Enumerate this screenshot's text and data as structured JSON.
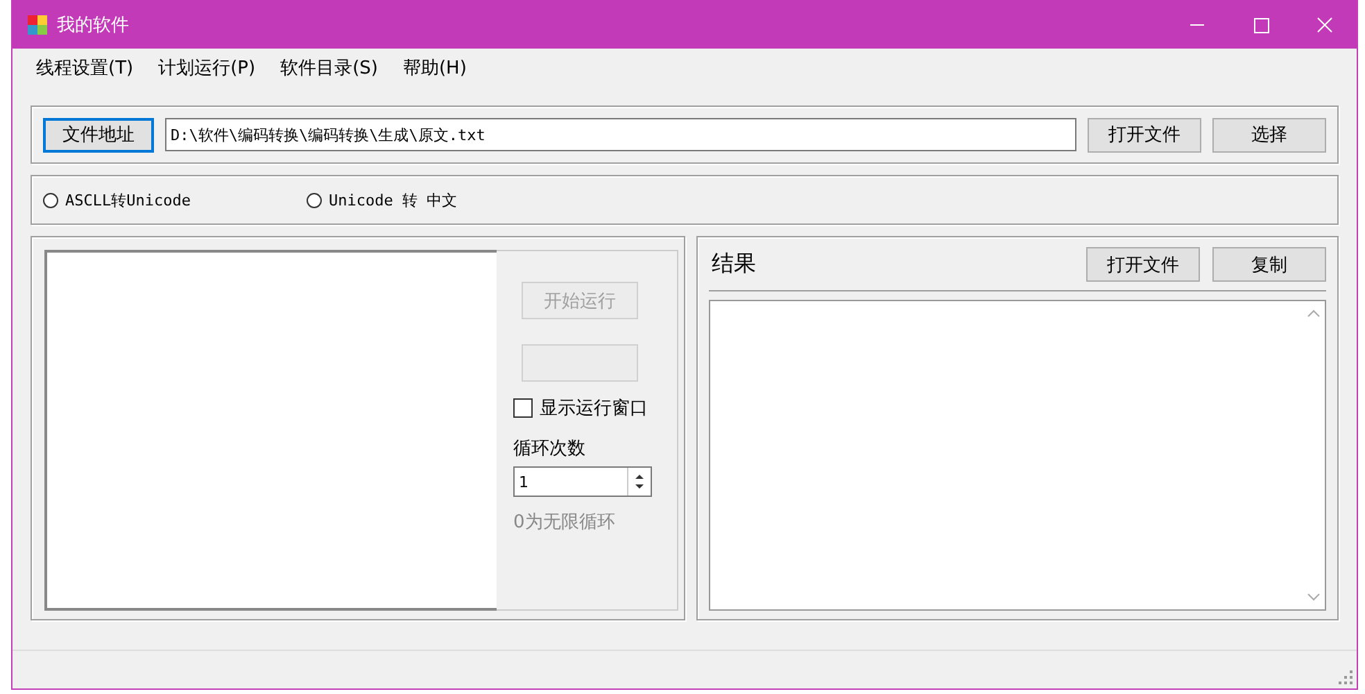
{
  "window": {
    "title": "我的软件"
  },
  "menu": [
    {
      "label": "线程设置(T)"
    },
    {
      "label": "计划运行(P)"
    },
    {
      "label": "软件目录(S)"
    },
    {
      "label": "帮助(H)"
    }
  ],
  "file_row": {
    "button": "文件地址",
    "path": "D:\\软件\\编码转换\\编码转换\\生成\\原文.txt",
    "buttons": [
      "打开文件",
      "选择"
    ]
  },
  "modes": [
    {
      "label": "ASCLL转Unicode",
      "selected": false
    },
    {
      "label": "Unicode 转 中文",
      "selected": false
    }
  ],
  "controls": {
    "start_button": {
      "label": "开始运行",
      "disabled": true
    },
    "second_button": {
      "disabled": true
    },
    "show_window": {
      "label": "显示运行窗口",
      "checked": false
    },
    "loop_label": "循环次数",
    "loop_value": "1",
    "loop_hint": "0为无限循环"
  },
  "result": {
    "title": "结果",
    "buttons": [
      "打开文件",
      "复制"
    ]
  }
}
